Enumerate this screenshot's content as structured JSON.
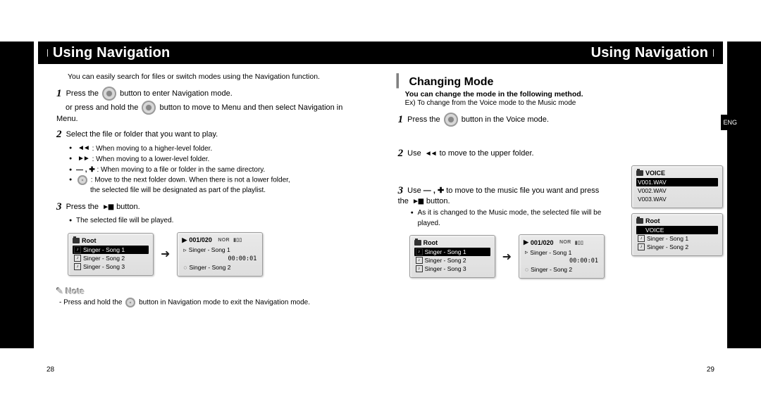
{
  "header": {
    "title_left": "Using Navigation",
    "title_right": "Using Navigation"
  },
  "page_numbers": {
    "left": "28",
    "right": "29"
  },
  "side_tab": "ENG",
  "left": {
    "intro": "You can easily search for files or switch modes using the Navigation function.",
    "step1": {
      "a": "Press the",
      "b": "button to enter Navigation mode.",
      "c": "or press and hold the",
      "d": "button to move to Menu and then select Navigation in Menu."
    },
    "step2": {
      "head": "Select the file or folder that you want to play.",
      "b1": ": When moving to a higher-level folder.",
      "b2": ": When moving to a lower-level folder.",
      "b3": ": When moving to a file or folder in the same directory.",
      "b4a": ": Move to the next folder down. When there is not a lower folder,",
      "b4b": "the selected file will be designated as part of the playlist."
    },
    "step3": {
      "a": "Press the",
      "b": "button.",
      "sub": "The selected file will be played."
    },
    "note": {
      "label": "Note",
      "a": "Press and hold the",
      "b": "button in Navigation mode to exit the Navigation mode."
    },
    "screens": {
      "root": {
        "title": "Root",
        "rows": [
          "Singer - Song 1",
          "Singer - Song 2",
          "Singer - Song 3"
        ],
        "selected": 0
      },
      "play": {
        "counter": "001/020",
        "status": "NOR",
        "rows": [
          "Singer - Song 1",
          "00:00:01",
          "Singer - Song 2"
        ]
      }
    }
  },
  "right": {
    "subhead": "Changing Mode",
    "bold": "You can change the mode in the following method.",
    "ex": "Ex) To change from the Voice mode to the Music mode",
    "step1": {
      "a": "Press the",
      "b": "button in the Voice mode."
    },
    "step2": {
      "a": "Use",
      "b": "to move to the upper folder."
    },
    "step3": {
      "a": "Use",
      "b": "to move to the music file you want and press the",
      "c": "button.",
      "sub": "As it is changed to the Music mode, the selected file will be played."
    },
    "screens": {
      "voice": {
        "title": "VOICE",
        "rows": [
          "V001.WAV",
          "V002.WAV",
          "V003.WAV"
        ],
        "selected": 0
      },
      "root_voice": {
        "title": "Root",
        "rows": [
          "VOICE",
          "Singer - Song 1",
          "Singer - Song 2"
        ],
        "selected": 0
      },
      "root_songs": {
        "title": "Root",
        "rows": [
          "Singer - Song 1",
          "Singer - Song 2",
          "Singer - Song 3"
        ],
        "selected": 0
      },
      "play": {
        "counter": "001/020",
        "status": "NOR",
        "rows": [
          "Singer - Song 1",
          "00:00:01",
          "Singer - Song 2"
        ]
      }
    }
  }
}
